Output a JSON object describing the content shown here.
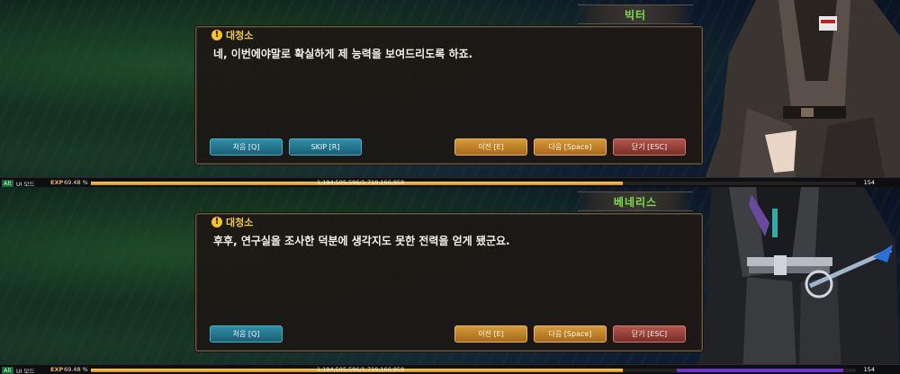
{
  "colors": {
    "speaker_accent": "#f1c44a",
    "name_green": "#7be04a",
    "exp_gold": "#e2b64c"
  },
  "panels": [
    {
      "name_plate": "빅터",
      "speaker": "대청소",
      "text": "네, 이번에야말로 확실하게 제 능력을 보여드리도록 하죠.",
      "buttons": {
        "first": "처음 [Q]",
        "skip": "SKIP [R]",
        "prev": "이전 [E]",
        "next": "다음 [Space]",
        "close": "닫기 [ESC]"
      },
      "status": {
        "mode_key": "Alt",
        "mode": "UI 모드",
        "exp_label": "EXP",
        "exp_pct": "69.48 %",
        "exp_value": "1,194,505,596/1,719,166,959",
        "level": "154"
      },
      "exp_progress": 0.6948,
      "warn_glyph": "!",
      "icon_names": [
        "warning-icon"
      ]
    },
    {
      "name_plate": "베네리스",
      "speaker": "대청소",
      "text": "후후, 연구실을 조사한 덕분에 생각지도 못한 전력을 얻게 됐군요.",
      "buttons": {
        "first": "처음 [Q]",
        "prev": "이전 [E]",
        "next": "다음 [Space]",
        "close": "닫기 [ESC]"
      },
      "status": {
        "mode_key": "Alt",
        "mode": "UI 모드",
        "exp_label": "EXP",
        "exp_pct": "69.48 %",
        "exp_value": "1,194,505,596/1,719,166,959",
        "level": "154"
      },
      "exp_progress": 0.6948,
      "warn_glyph": "!",
      "icon_names": [
        "warning-icon"
      ]
    }
  ]
}
